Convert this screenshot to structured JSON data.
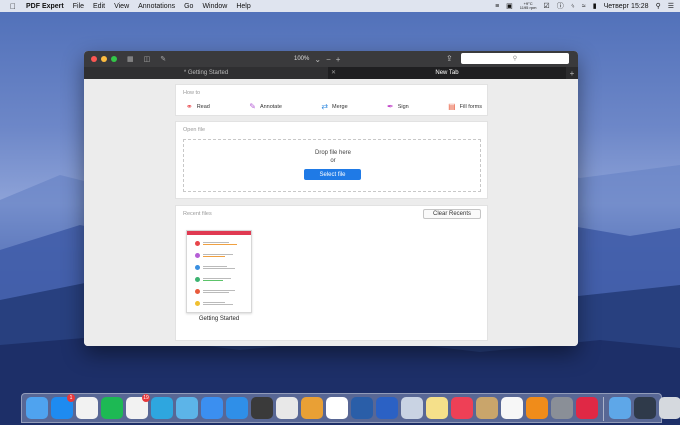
{
  "menubar": {
    "app_name": "PDF Expert",
    "items": [
      "File",
      "Edit",
      "View",
      "Annotations",
      "Go",
      "Window",
      "Help"
    ],
    "weather_temp": "+9°C",
    "weather_extra": "1195 rpm",
    "clock": "Четверг 15:28"
  },
  "window": {
    "zoom": "100%",
    "tabs": [
      {
        "label": "* Getting Started"
      },
      {
        "label": "New Tab"
      }
    ],
    "howto": {
      "title": "How to",
      "actions": [
        {
          "label": "Read",
          "icon": "glasses-icon",
          "color": "#e8454a"
        },
        {
          "label": "Annotate",
          "icon": "pen-icon",
          "color": "#b55fd6"
        },
        {
          "label": "Merge",
          "icon": "merge-icon",
          "color": "#3a8fe0"
        },
        {
          "label": "Sign",
          "icon": "sign-icon",
          "color": "#c247c9"
        },
        {
          "label": "Fill forms",
          "icon": "form-icon",
          "color": "#e85a3b"
        }
      ]
    },
    "open_file": {
      "title": "Open file",
      "drop_text": "Drop file here",
      "or_text": "or",
      "button": "Select file"
    },
    "recent": {
      "title": "Recent files",
      "clear_button": "Clear Recents",
      "files": [
        {
          "name": "Getting Started"
        }
      ]
    }
  },
  "dock": {
    "icons": [
      {
        "name": "finder",
        "color": "#4fa3ef"
      },
      {
        "name": "app-store",
        "color": "#1e8bf0",
        "badge": "1"
      },
      {
        "name": "itunes",
        "color": "#f2f2f2"
      },
      {
        "name": "spotify",
        "color": "#1db954"
      },
      {
        "name": "clock",
        "color": "#f2f2f2",
        "badge": "19"
      },
      {
        "name": "telegram",
        "color": "#2ea6df"
      },
      {
        "name": "angry-app",
        "color": "#5cb4e8"
      },
      {
        "name": "messages",
        "color": "#3b8ff0"
      },
      {
        "name": "safari",
        "color": "#2f8fe8"
      },
      {
        "name": "writer",
        "color": "#3a3a3a"
      },
      {
        "name": "notes-pencil",
        "color": "#e8e8e8"
      },
      {
        "name": "toolbox",
        "color": "#e9a035"
      },
      {
        "name": "calendar",
        "color": "#ffffff"
      },
      {
        "name": "download-app",
        "color": "#2a5ea8"
      },
      {
        "name": "tasks",
        "color": "#2b61c4"
      },
      {
        "name": "screenshot",
        "color": "#c9d3e3"
      },
      {
        "name": "stickies",
        "color": "#f5e08a"
      },
      {
        "name": "pocket",
        "color": "#ee4056"
      },
      {
        "name": "archiver",
        "color": "#c9a56b"
      },
      {
        "name": "photos",
        "color": "#f7f7f7"
      },
      {
        "name": "vlc",
        "color": "#f08c1a"
      },
      {
        "name": "system-preferences",
        "color": "#8a8f97"
      },
      {
        "name": "pdf-expert",
        "color": "#e02845"
      },
      {
        "name": "folder",
        "color": "#5ea7e8"
      },
      {
        "name": "phone",
        "color": "#2f3a4a"
      },
      {
        "name": "trash",
        "color": "#d5d9de"
      }
    ]
  }
}
